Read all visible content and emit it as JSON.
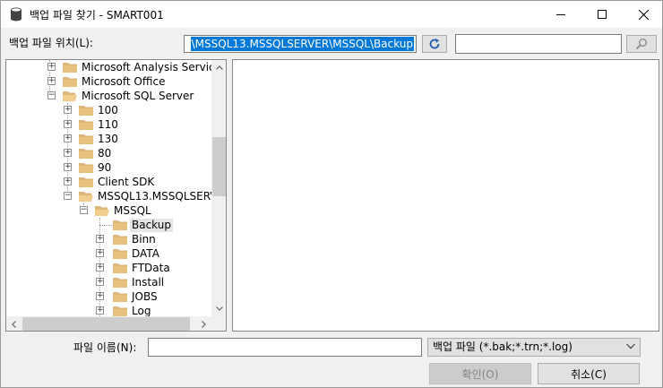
{
  "window": {
    "title": "백업 파일 찾기 - SMART001"
  },
  "location": {
    "label": "백업 파일 위치(L):",
    "path_value": "\\MSSQL13.MSSQLSERVER\\MSSQL\\Backup"
  },
  "search": {
    "value": ""
  },
  "tree": {
    "items": [
      {
        "label": "Microsoft Analysis Services",
        "expander": "+"
      },
      {
        "label": "Microsoft Office",
        "expander": "+"
      },
      {
        "label": "Microsoft SQL Server",
        "expander": "−"
      },
      {
        "label": "100",
        "expander": "+"
      },
      {
        "label": "110",
        "expander": "+"
      },
      {
        "label": "130",
        "expander": "+"
      },
      {
        "label": "80",
        "expander": "+"
      },
      {
        "label": "90",
        "expander": "+"
      },
      {
        "label": "Client SDK",
        "expander": "+"
      },
      {
        "label": "MSSQL13.MSSQLSERVER",
        "expander": "−"
      },
      {
        "label": "MSSQL",
        "expander": "−"
      },
      {
        "label": "Backup",
        "expander": "",
        "selected": true
      },
      {
        "label": "Binn",
        "expander": "+"
      },
      {
        "label": "DATA",
        "expander": "+"
      },
      {
        "label": "FTData",
        "expander": "+"
      },
      {
        "label": "Install",
        "expander": "+"
      },
      {
        "label": "JOBS",
        "expander": "+"
      },
      {
        "label": "Log",
        "expander": "+"
      }
    ]
  },
  "filename": {
    "label": "파일 이름(N):",
    "value": ""
  },
  "filetype": {
    "selected": "백업 파일 (*.bak;*.trn;*.log)"
  },
  "buttons": {
    "ok": "확인(O)",
    "cancel": "취소(C)"
  },
  "colors": {
    "selection": "#0078d7",
    "folder": "#dcb67a"
  }
}
